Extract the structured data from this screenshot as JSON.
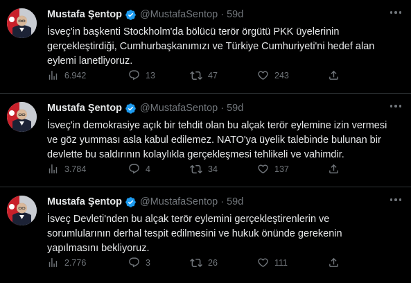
{
  "colors": {
    "background": "#000000",
    "text": "#e7e9ea",
    "muted": "#71767b",
    "verified": "#1d9bf0",
    "divider": "#2f3336"
  },
  "icons": {
    "views": "bar-chart-icon",
    "reply": "speech-bubble-icon",
    "retweet": "retweet-arrows-icon",
    "like": "heart-icon",
    "share": "share-upload-icon",
    "verified": "verified-badge-icon",
    "more": "more-dots-icon"
  },
  "tweets": [
    {
      "author": "Mustafa Şentop",
      "handle": "@MustafaSentop",
      "separator": "·",
      "time": "59d",
      "text": "İsveç'in başkenti Stockholm'da bölücü terör örgütü PKK üyelerinin\ngerçekleştirdiği, Cumhurbaşkanımızı ve Türkiye Cumhuriyeti'ni hedef alan\neylemi lanetliyoruz.",
      "views": "6.942",
      "replies": "13",
      "retweets": "47",
      "likes": "243"
    },
    {
      "author": "Mustafa Şentop",
      "handle": "@MustafaSentop",
      "separator": "·",
      "time": "59d",
      "text": "İsveç'in demokrasiye açık bir tehdit olan bu alçak terör eylemine izin vermesi\nve göz yumması asla kabul edilemez. NATO'ya üyelik talebinde bulunan bir\ndevlette bu saldırının kolaylıkla gerçekleşmesi tehlikeli ve vahimdir.",
      "views": "3.784",
      "replies": "4",
      "retweets": "34",
      "likes": "137"
    },
    {
      "author": "Mustafa Şentop",
      "handle": "@MustafaSentop",
      "separator": "·",
      "time": "59d",
      "text": "İsveç Devleti'nden bu alçak terör eylemini gerçekleştirenlerin ve\nsorumlularının derhal tespit edilmesini ve hukuk önünde gerekenin\nyapılmasını bekliyoruz.",
      "views": "2.776",
      "replies": "3",
      "retweets": "26",
      "likes": "111"
    }
  ]
}
